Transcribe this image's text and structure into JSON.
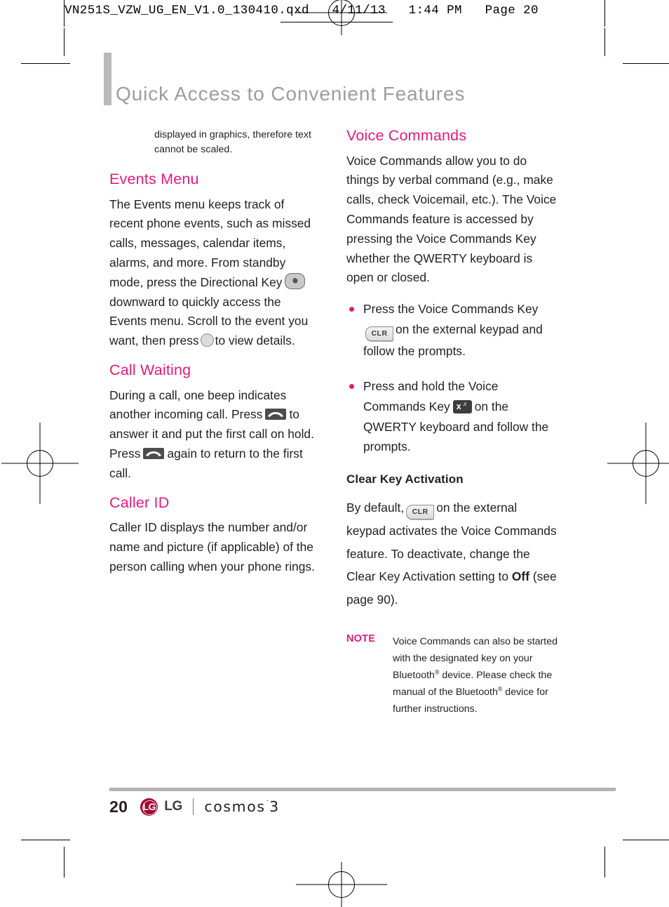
{
  "slug": {
    "text": "VN251S_VZW_UG_EN_V1.0_130410.qxd   4/11/13   1:44 PM   Page 20"
  },
  "running_head": {
    "title": "Quick Access to Convenient Features"
  },
  "colors": {
    "heading_pink": "#e6197e",
    "running_head_gray": "#9d9d9d",
    "body_black": "#231f20",
    "lg_crimson": "#a50034"
  },
  "left_column": {
    "intro": "displayed in graphics, therefore text cannot be scaled.",
    "sections": [
      {
        "heading": "Events Menu",
        "paragraph_part_1": "The Events menu keeps track of recent phone events, such as missed calls, messages, calendar items, alarms, and more.  From standby mode, press the Directional Key",
        "icon_1": "directional-key-icon",
        "paragraph_part_2": "downward to quickly access the Events menu. Scroll to the event you want, then press",
        "icon_2": "ok-key-icon",
        "paragraph_part_3": "to view details."
      },
      {
        "heading": "Call Waiting",
        "paragraph_part_1": "During a call, one beep indicates another incoming call. Press",
        "icon_1": "send-key-icon",
        "paragraph_part_2": "to answer it and put the first call on hold. Press",
        "icon_2": "send-key-icon",
        "paragraph_part_3": "again to return to the first call."
      },
      {
        "heading": "Caller ID",
        "paragraph": "Caller ID displays the number and/or name and picture (if applicable) of the person calling when your phone rings."
      }
    ]
  },
  "right_column": {
    "heading": "Voice Commands",
    "paragraph": "Voice Commands allow you to do things by verbal command (e.g., make calls, check Voicemail, etc.). The Voice Commands feature is accessed by pressing the Voice Commands Key whether the QWERTY keyboard is open or closed.",
    "bullets": [
      {
        "part_1": "Press the Voice Commands Key",
        "icon": "clr-key-icon",
        "icon_label": "CLR",
        "part_2": "on the external keypad and follow the prompts."
      },
      {
        "part_1": "Press and hold the Voice Commands Key",
        "icon": "voice-command-x-key-icon",
        "icon_label": "x",
        "part_2": "on the QWERTY keyboard and follow the prompts."
      }
    ],
    "subsection": {
      "heading": "Clear Key Activation",
      "part_1": "By default,",
      "icon": "clr-key-icon",
      "icon_label": "CLR",
      "part_2": "on the external keypad activates the Voice Commands feature. To deactivate, change the Clear Key Activation setting to",
      "emphasis": "Off",
      "part_3": "(see page 90)."
    },
    "note": {
      "label": "NOTE",
      "text_1": "Voice Commands can also be started with the designated key on your Bluetooth",
      "reg_1": "®",
      "text_2": " device. Please check the manual of the Bluetooth",
      "reg_2": "®",
      "text_3": " device for further instructions."
    }
  },
  "footer": {
    "page_number": "20",
    "brand_word": "LG",
    "brand_mark_text": "LG",
    "product": "cosmos",
    "product_tm": "˙",
    "product_version": "3"
  }
}
